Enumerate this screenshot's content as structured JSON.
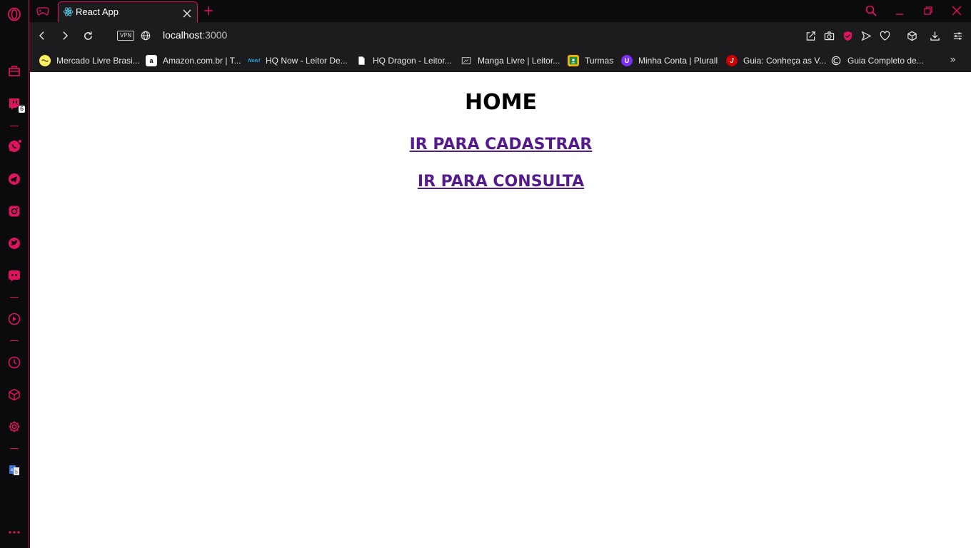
{
  "colors": {
    "accent": "#e0135f",
    "chrome_bg": "#1c1c1f",
    "frame_bg": "#0b0b0d",
    "link_visited": "#551a8b"
  },
  "sidebar": {
    "items": [
      {
        "icon": "opera-logo-icon"
      },
      {
        "icon": "briefcase-icon"
      },
      {
        "icon": "twitch-icon",
        "badge": "6"
      },
      {
        "icon": "whatsapp-icon"
      },
      {
        "icon": "telegram-icon"
      },
      {
        "icon": "instagram-icon"
      },
      {
        "icon": "twitter-icon"
      },
      {
        "icon": "discord-icon"
      },
      {
        "icon": "player-icon"
      },
      {
        "icon": "history-icon"
      },
      {
        "icon": "cube-icon"
      },
      {
        "icon": "settings-icon"
      },
      {
        "icon": "translate-icon"
      },
      {
        "icon": "more-icon"
      }
    ]
  },
  "tabs": [
    {
      "title": "React App",
      "icon": "react-icon",
      "active": true
    }
  ],
  "address": {
    "url_host": "localhost",
    "url_port": ":3000",
    "vpn_label": "VPN"
  },
  "bookmarks": [
    {
      "label": "Mercado Livre Brasi...",
      "icon": "mercadolivre-icon"
    },
    {
      "label": "Amazon.com.br | T...",
      "icon": "amazon-icon"
    },
    {
      "label": "HQ Now - Leitor De...",
      "icon": "hqnow-icon"
    },
    {
      "label": "HQ Dragon - Leitor...",
      "icon": "document-icon"
    },
    {
      "label": "Manga Livre | Leitor...",
      "icon": "manga-icon"
    },
    {
      "label": "Turmas",
      "icon": "classroom-icon"
    },
    {
      "label": "Minha Conta | Plurall",
      "icon": "plurall-icon"
    },
    {
      "label": "Guia: Conheça as V...",
      "icon": "java-icon"
    },
    {
      "label": "Guia Completo de...",
      "icon": "site-icon"
    }
  ],
  "page": {
    "heading": "HOME",
    "links": [
      {
        "label": "IR PARA CADASTRAR"
      },
      {
        "label": "IR PARA CONSULTA"
      }
    ]
  }
}
